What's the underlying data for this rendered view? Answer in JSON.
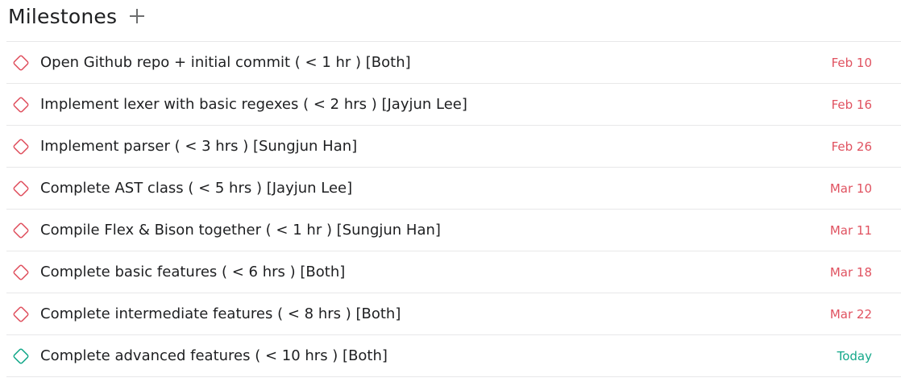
{
  "header": {
    "title": "Milestones",
    "add_icon": "plus-icon"
  },
  "colors": {
    "overdue": "#e05260",
    "today": "#14a88a",
    "divider": "#e8e8e9",
    "text": "#1e1f21"
  },
  "milestones": [
    {
      "name": "Open Github repo + initial commit ( < 1 hr ) [Both]",
      "due": "Feb 10",
      "status": "overdue"
    },
    {
      "name": "Implement lexer with basic regexes ( < 2 hrs ) [Jayjun Lee]",
      "due": "Feb 16",
      "status": "overdue"
    },
    {
      "name": "Implement parser ( < 3 hrs ) [Sungjun Han]",
      "due": "Feb 26",
      "status": "overdue"
    },
    {
      "name": "Complete AST class ( < 5 hrs ) [Jayjun Lee]",
      "due": "Mar 10",
      "status": "overdue"
    },
    {
      "name": "Compile Flex & Bison together ( < 1 hr ) [Sungjun Han]",
      "due": "Mar 11",
      "status": "overdue"
    },
    {
      "name": "Complete basic features ( < 6 hrs ) [Both]",
      "due": "Mar 18",
      "status": "overdue"
    },
    {
      "name": "Complete intermediate features ( < 8 hrs ) [Both]",
      "due": "Mar 22",
      "status": "overdue"
    },
    {
      "name": "Complete advanced features ( < 10 hrs ) [Both]",
      "due": "Today",
      "status": "today"
    }
  ]
}
